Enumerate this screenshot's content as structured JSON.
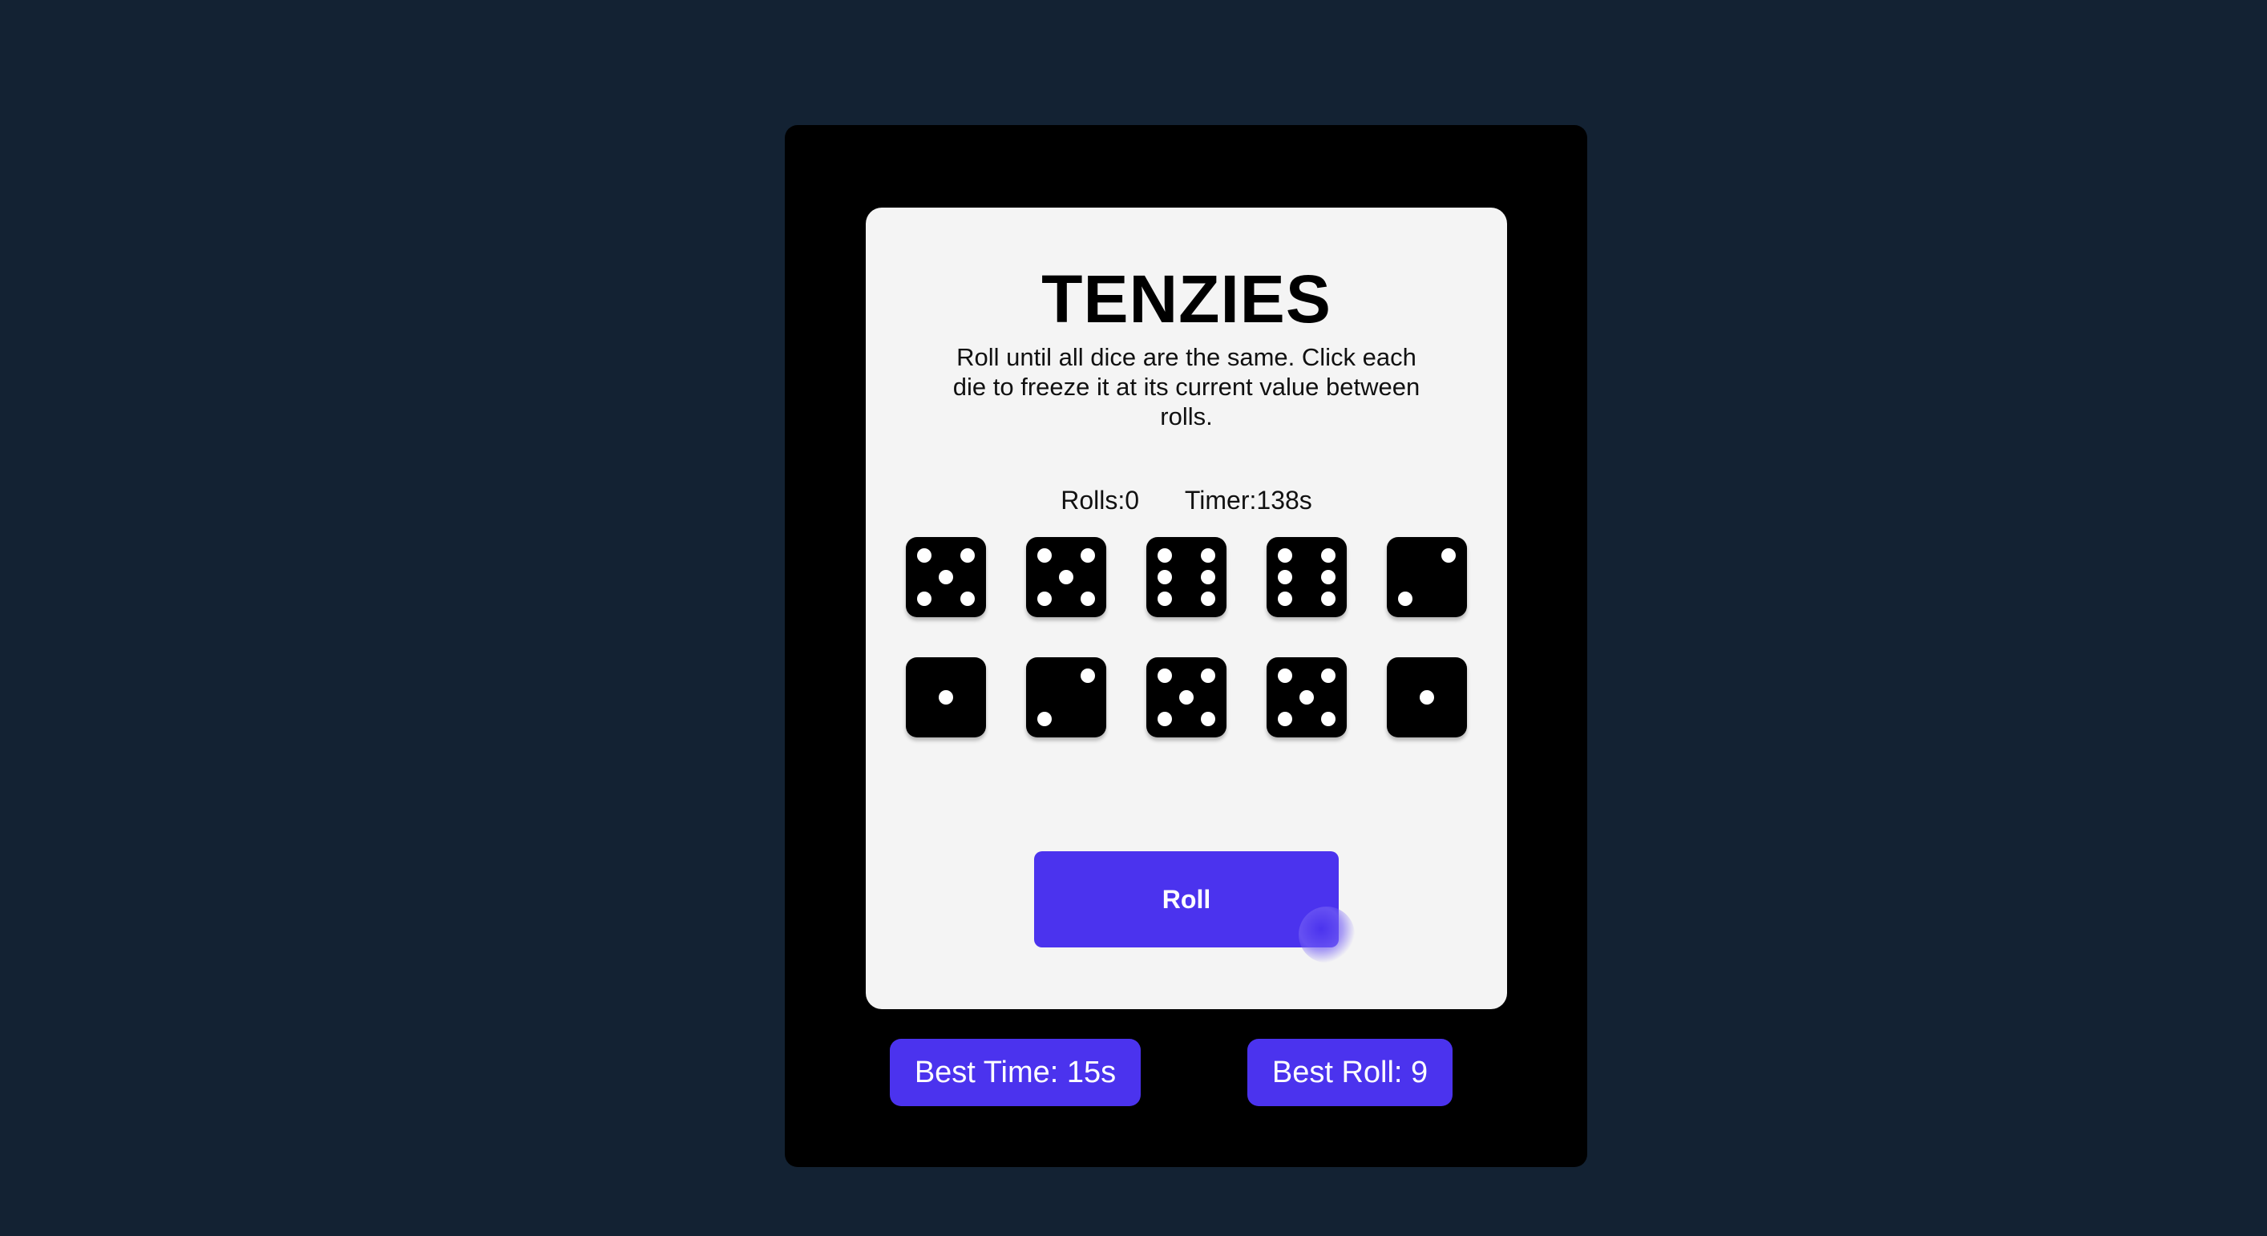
{
  "game": {
    "title": "TENZIES",
    "instructions": "Roll until all dice are the same. Click each die to freeze it at its current value between rolls.",
    "rolls_label": "Rolls:0",
    "timer_label": "Timer:138s",
    "roll_button_label": "Roll"
  },
  "dice": [
    5,
    5,
    6,
    6,
    2,
    1,
    2,
    5,
    5,
    1
  ],
  "best": {
    "time_label": "Best Time: 15s",
    "roll_label": "Best Roll: 9"
  },
  "colors": {
    "background": "#132233",
    "frame": "#000000",
    "board": "#f4f4f4",
    "accent": "#4b33ee",
    "die": "#000000",
    "pip": "#ffffff"
  }
}
